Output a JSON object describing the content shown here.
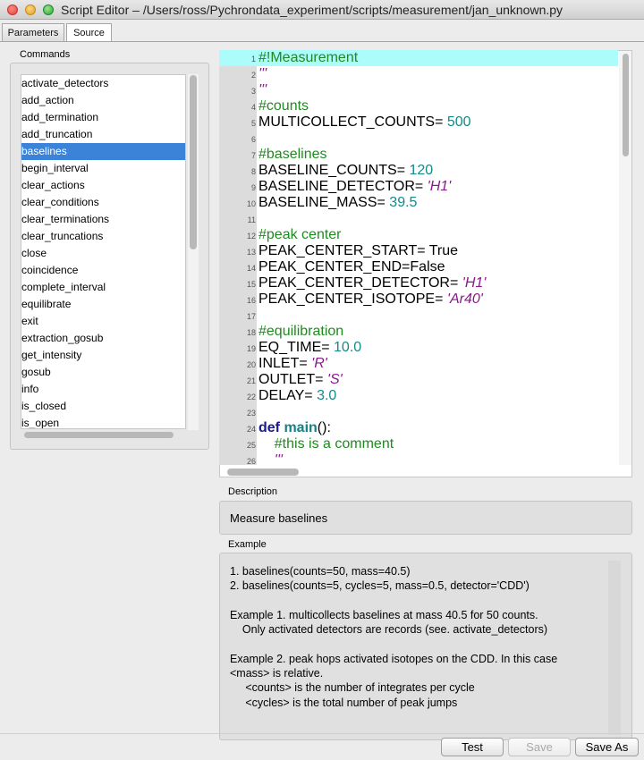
{
  "window": {
    "title": "Script Editor – /Users/ross/Pychrondata_experiment/scripts/measurement/jan_unknown.py"
  },
  "tabs": [
    {
      "label": "Parameters",
      "active": false
    },
    {
      "label": "Source",
      "active": true
    }
  ],
  "commands": {
    "label": "Commands",
    "selected": "baselines",
    "items": [
      "activate_detectors",
      "add_action",
      "add_termination",
      "add_truncation",
      "baselines",
      "begin_interval",
      "clear_actions",
      "clear_conditions",
      "clear_terminations",
      "clear_truncations",
      "close",
      "coincidence",
      "complete_interval",
      "equilibrate",
      "exit",
      "extraction_gosub",
      "get_intensity",
      "gosub",
      "info",
      "is_closed",
      "is_open"
    ]
  },
  "editor": {
    "highlight_color": "#adfcfc",
    "lines": [
      {
        "n": "1",
        "segs": [
          [
            "cm",
            "#!Measurement"
          ]
        ],
        "hl": true
      },
      {
        "n": "2",
        "segs": [
          [
            "str",
            "'''"
          ]
        ]
      },
      {
        "n": "3",
        "segs": [
          [
            "str",
            "'''"
          ]
        ]
      },
      {
        "n": "4",
        "segs": [
          [
            "cm",
            "#counts"
          ]
        ]
      },
      {
        "n": "5",
        "segs": [
          [
            "",
            "MULTICOLLECT_COUNTS= "
          ],
          [
            "num",
            "500"
          ]
        ]
      },
      {
        "n": "6",
        "segs": []
      },
      {
        "n": "7",
        "segs": [
          [
            "cm",
            "#baselines"
          ]
        ]
      },
      {
        "n": "8",
        "segs": [
          [
            "",
            "BASELINE_COUNTS= "
          ],
          [
            "num",
            "120"
          ]
        ]
      },
      {
        "n": "9",
        "segs": [
          [
            "",
            "BASELINE_DETECTOR= "
          ],
          [
            "str",
            "'H1'"
          ]
        ]
      },
      {
        "n": "10",
        "segs": [
          [
            "",
            "BASELINE_MASS= "
          ],
          [
            "num",
            "39.5"
          ]
        ]
      },
      {
        "n": "11",
        "segs": []
      },
      {
        "n": "12",
        "segs": [
          [
            "cm",
            "#peak center"
          ]
        ]
      },
      {
        "n": "13",
        "segs": [
          [
            "",
            "PEAK_CENTER_START= True"
          ]
        ]
      },
      {
        "n": "14",
        "segs": [
          [
            "",
            "PEAK_CENTER_END=False"
          ]
        ]
      },
      {
        "n": "15",
        "segs": [
          [
            "",
            "PEAK_CENTER_DETECTOR= "
          ],
          [
            "str",
            "'H1'"
          ]
        ]
      },
      {
        "n": "16",
        "segs": [
          [
            "",
            "PEAK_CENTER_ISOTOPE= "
          ],
          [
            "str",
            "'Ar40'"
          ]
        ]
      },
      {
        "n": "17",
        "segs": []
      },
      {
        "n": "18",
        "segs": [
          [
            "cm",
            "#equilibration"
          ]
        ]
      },
      {
        "n": "19",
        "segs": [
          [
            "",
            "EQ_TIME= "
          ],
          [
            "num",
            "10.0"
          ]
        ]
      },
      {
        "n": "20",
        "segs": [
          [
            "",
            "INLET= "
          ],
          [
            "str",
            "'R'"
          ]
        ]
      },
      {
        "n": "21",
        "segs": [
          [
            "",
            "OUTLET= "
          ],
          [
            "str",
            "'S'"
          ]
        ]
      },
      {
        "n": "22",
        "segs": [
          [
            "",
            "DELAY= "
          ],
          [
            "num",
            "3.0"
          ]
        ]
      },
      {
        "n": "23",
        "segs": []
      },
      {
        "n": "24",
        "segs": [
          [
            "kw",
            "def "
          ],
          [
            "fn",
            "main"
          ],
          [
            "",
            "():"
          ]
        ]
      },
      {
        "n": "25",
        "segs": [
          [
            "",
            "    "
          ],
          [
            "cm",
            "#this is a comment"
          ]
        ]
      },
      {
        "n": "26",
        "segs": [
          [
            "",
            "    "
          ],
          [
            "str",
            "'''"
          ]
        ]
      }
    ]
  },
  "description": {
    "label": "Description",
    "text": "Measure baselines"
  },
  "example": {
    "label": "Example",
    "text": "1. baselines(counts=50, mass=40.5)\n2. baselines(counts=5, cycles=5, mass=0.5, detector='CDD')\n\nExample 1. multicollects baselines at mass 40.5 for 50 counts.\n    Only activated detectors are records (see. activate_detectors)\n\nExample 2. peak hops activated isotopes on the CDD. In this case\n<mass> is relative.\n     <counts> is the number of integrates per cycle\n     <cycles> is the total number of peak jumps"
  },
  "buttons": {
    "test": "Test",
    "save": "Save",
    "save_as": "Save As"
  }
}
